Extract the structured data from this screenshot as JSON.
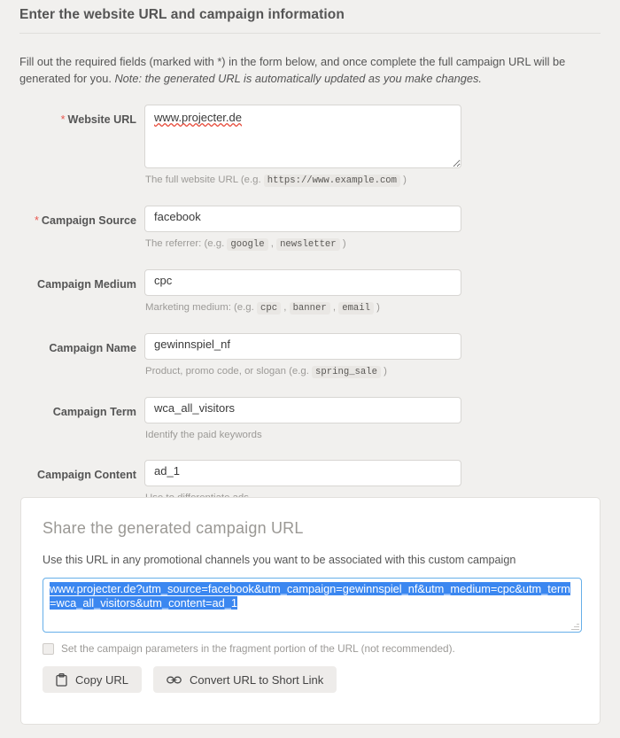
{
  "header": {
    "title": "Enter the website URL and campaign information"
  },
  "intro": {
    "text": "Fill out the required fields (marked with *) in the form below, and once complete the full campaign URL will be generated for you. ",
    "note": "Note: the generated URL is automatically updated as you make changes."
  },
  "form": {
    "fields": [
      {
        "label": "Website URL",
        "required": true,
        "value": "www.projecter.de",
        "help_prefix": "The full website URL (e.g. ",
        "help_chips": [
          "https://www.example.com"
        ],
        "help_suffix": " )",
        "type": "textarea"
      },
      {
        "label": "Campaign Source",
        "required": true,
        "value": "facebook",
        "help_prefix": "The referrer: (e.g. ",
        "help_chips": [
          "google",
          "newsletter"
        ],
        "help_suffix": " )",
        "type": "text"
      },
      {
        "label": "Campaign Medium",
        "required": false,
        "value": "cpc",
        "help_prefix": "Marketing medium: (e.g. ",
        "help_chips": [
          "cpc",
          "banner",
          "email"
        ],
        "help_suffix": " )",
        "type": "text"
      },
      {
        "label": "Campaign Name",
        "required": false,
        "value": "gewinnspiel_nf",
        "help_prefix": "Product, promo code, or slogan (e.g. ",
        "help_chips": [
          "spring_sale"
        ],
        "help_suffix": " )",
        "type": "text"
      },
      {
        "label": "Campaign Term",
        "required": false,
        "value": "wca_all_visitors",
        "help_prefix": "Identify the paid keywords",
        "help_chips": [],
        "help_suffix": "",
        "type": "text"
      },
      {
        "label": "Campaign Content",
        "required": false,
        "value": "ad_1",
        "help_prefix": "Use to differentiate ads",
        "help_chips": [],
        "help_suffix": "",
        "type": "text"
      }
    ],
    "required_marker": "*"
  },
  "share": {
    "title": "Share the generated campaign URL",
    "subtitle": "Use this URL in any promotional channels you want to be associated with this custom campaign",
    "generated_url": "www.projecter.de?utm_source=facebook&utm_campaign=gewinnspiel_nf&utm_medium=cpc&utm_term=wca_all_visitors&utm_content=ad_1",
    "fragment_checkbox_label": "Set the campaign parameters in the fragment portion of the URL (not recommended).",
    "copy_button_label": "Copy URL",
    "convert_button_label": "Convert URL to Short Link",
    "icons": {
      "copy": "clipboard-icon",
      "convert": "link-icon"
    }
  },
  "colors": {
    "page_background": "#f1f0ee",
    "accent_required": "#e8554d",
    "focus_border": "#66afe9",
    "selection": "#3b87f0",
    "panel_background": "#ffffff"
  }
}
